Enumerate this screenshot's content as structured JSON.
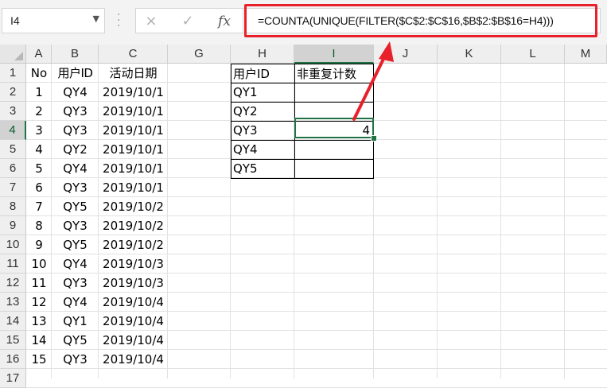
{
  "name_box": {
    "value": "I4"
  },
  "formula_bar": {
    "cancel_icon": "×",
    "enter_icon": "✓",
    "fx_label": "fx",
    "formula": "=COUNTA(UNIQUE(FILTER($C$2:$C$16,$B$2:$B$16=H4)))"
  },
  "columns": [
    "A",
    "B",
    "C",
    "G",
    "H",
    "I",
    "J",
    "K",
    "L",
    "M"
  ],
  "rows": [
    "1",
    "2",
    "3",
    "4",
    "5",
    "6",
    "7",
    "8",
    "9",
    "10",
    "11",
    "12",
    "13",
    "14",
    "15",
    "16",
    "17"
  ],
  "header_row": {
    "a": "No",
    "b": "用户ID",
    "c": "活动日期"
  },
  "data_rows": [
    {
      "no": "1",
      "id": "QY4",
      "date": "2019/10/1"
    },
    {
      "no": "2",
      "id": "QY3",
      "date": "2019/10/1"
    },
    {
      "no": "3",
      "id": "QY3",
      "date": "2019/10/1"
    },
    {
      "no": "4",
      "id": "QY2",
      "date": "2019/10/1"
    },
    {
      "no": "5",
      "id": "QY4",
      "date": "2019/10/1"
    },
    {
      "no": "6",
      "id": "QY3",
      "date": "2019/10/1"
    },
    {
      "no": "7",
      "id": "QY5",
      "date": "2019/10/2"
    },
    {
      "no": "8",
      "id": "QY3",
      "date": "2019/10/2"
    },
    {
      "no": "9",
      "id": "QY5",
      "date": "2019/10/2"
    },
    {
      "no": "10",
      "id": "QY4",
      "date": "2019/10/3"
    },
    {
      "no": "11",
      "id": "QY3",
      "date": "2019/10/3"
    },
    {
      "no": "12",
      "id": "QY4",
      "date": "2019/10/4"
    },
    {
      "no": "13",
      "id": "QY1",
      "date": "2019/10/4"
    },
    {
      "no": "14",
      "id": "QY5",
      "date": "2019/10/4"
    },
    {
      "no": "15",
      "id": "QY3",
      "date": "2019/10/4"
    }
  ],
  "summary_table": {
    "header": {
      "h": "用户ID",
      "i": "非重复计数"
    },
    "rows": [
      {
        "id": "QY1",
        "count": ""
      },
      {
        "id": "QY2",
        "count": ""
      },
      {
        "id": "QY3",
        "count": "4"
      },
      {
        "id": "QY4",
        "count": ""
      },
      {
        "id": "QY5",
        "count": ""
      }
    ]
  },
  "colors": {
    "highlight": "#e8202a",
    "selection": "#217346"
  }
}
